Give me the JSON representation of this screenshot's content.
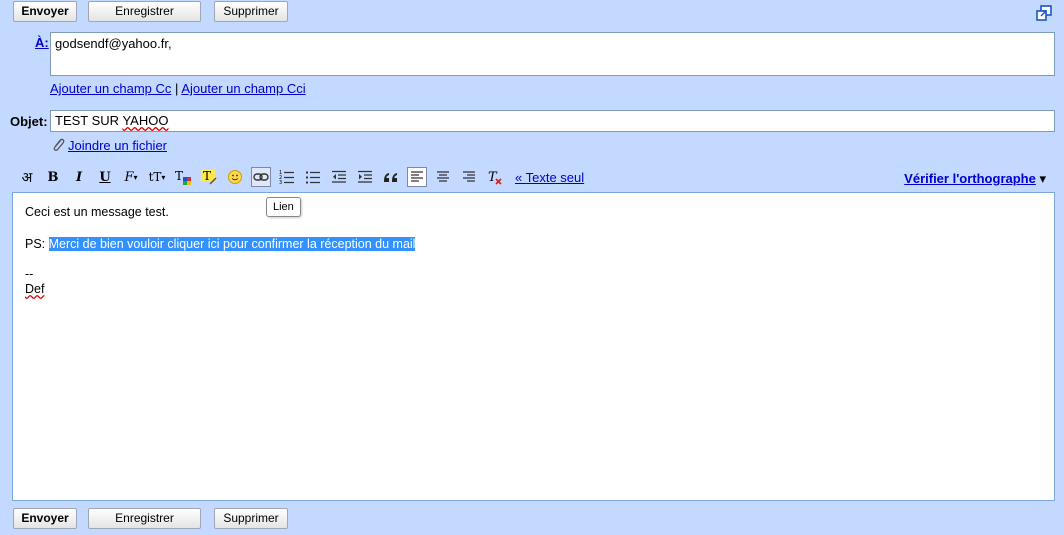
{
  "toolbar": {
    "send_label": "Envoyer",
    "save_label": "Enregistrer",
    "delete_label": "Supprimer"
  },
  "to": {
    "label": "À:",
    "value": "godsendf@yahoo.fr,"
  },
  "cc_links": {
    "add_cc": "Ajouter un champ Cc",
    "separator": "|",
    "add_bcc": "Ajouter un champ Cci"
  },
  "subject": {
    "label": "Objet:",
    "value_prefix": "TEST SUR ",
    "value_misspelled": "YAHOO"
  },
  "attach": {
    "label": "Joindre un fichier"
  },
  "format_toolbar": {
    "hindi_glyph": "अ",
    "bold": "B",
    "italic": "I",
    "underline": "U",
    "font_glyph": "F",
    "size_glyph": "tT",
    "plain_text_link": "« Texte seul",
    "spellcheck_label": "Vérifier l'orthographe",
    "spellcheck_arrow": "▾"
  },
  "tooltip": {
    "text": "Lien"
  },
  "message": {
    "line1": "Ceci est un message test.",
    "ps_label": "PS: ",
    "ps_highlight": "Merci de bien vouloir cliquer ici pour confirmer la réception du mail",
    "sig_sep": "--",
    "sig_name": "Def"
  },
  "colors": {
    "background": "#c3d9ff",
    "link": "#0000cc",
    "selection": "#3390ff"
  }
}
